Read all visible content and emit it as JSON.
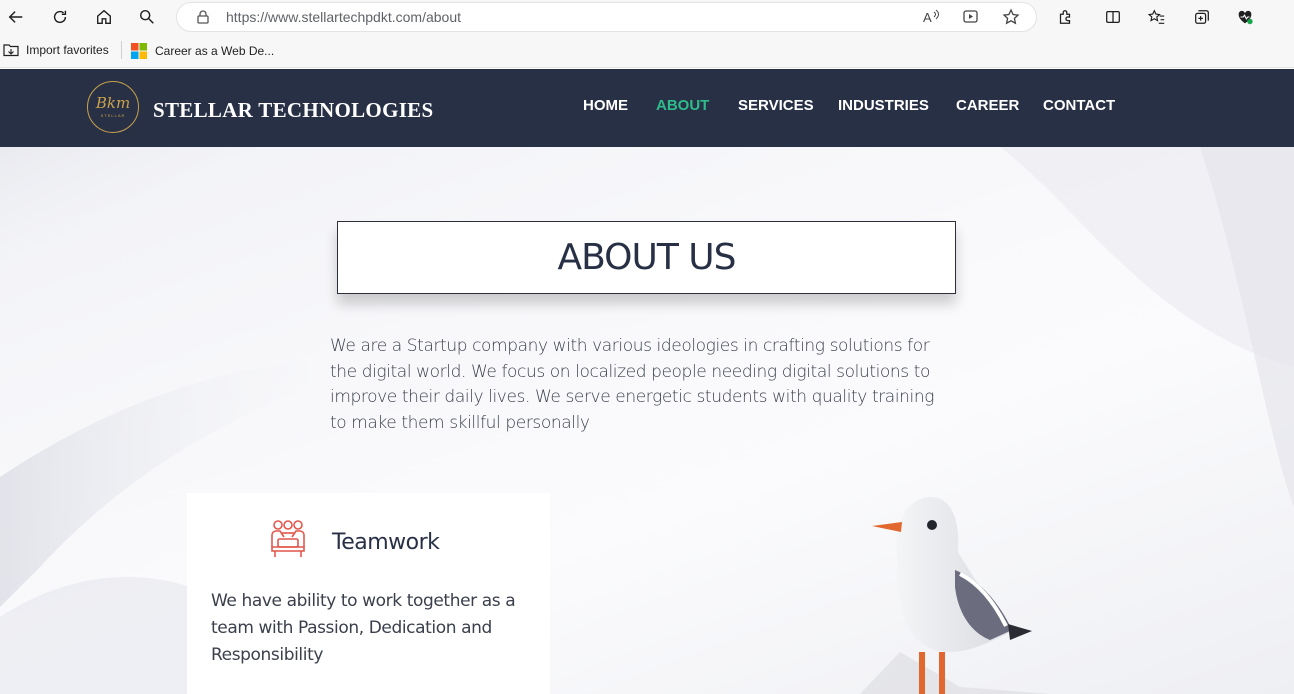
{
  "browser": {
    "url": "https://www.stellartechpdkt.com/about",
    "favorites": [
      {
        "label": "Import favorites",
        "icon": "import-favorites-icon"
      },
      {
        "label": "Career as a Web De...",
        "icon": "microsoft-logo-icon"
      }
    ]
  },
  "site": {
    "brand": "STELLAR TECHNOLOGIES",
    "logo_text": "Bkm",
    "logo_subtext": "STELLAR",
    "nav": [
      {
        "label": "HOME",
        "active": false
      },
      {
        "label": "ABOUT",
        "active": true
      },
      {
        "label": "SERVICES",
        "active": false
      },
      {
        "label": "INDUSTRIES",
        "active": false
      },
      {
        "label": "CAREER",
        "active": false
      },
      {
        "label": "CONTACT",
        "active": false
      }
    ]
  },
  "about": {
    "title": "ABOUT US",
    "text": "We are a Startup company with various ideologies in crafting solutions for the digital world. We focus on localized people needing digital solutions to improve their daily lives. We serve energetic students with quality training to make them skillful personally"
  },
  "card": {
    "title": "Teamwork",
    "text": "We have ability to work together as a team with Passion, Dedication and Responsibility",
    "icon": "teamwork-icon"
  },
  "colors": {
    "navbar": "#283046",
    "active_nav": "#2ebd8a",
    "logo_gold": "#c9a14a",
    "icon_red": "#e2574c"
  }
}
